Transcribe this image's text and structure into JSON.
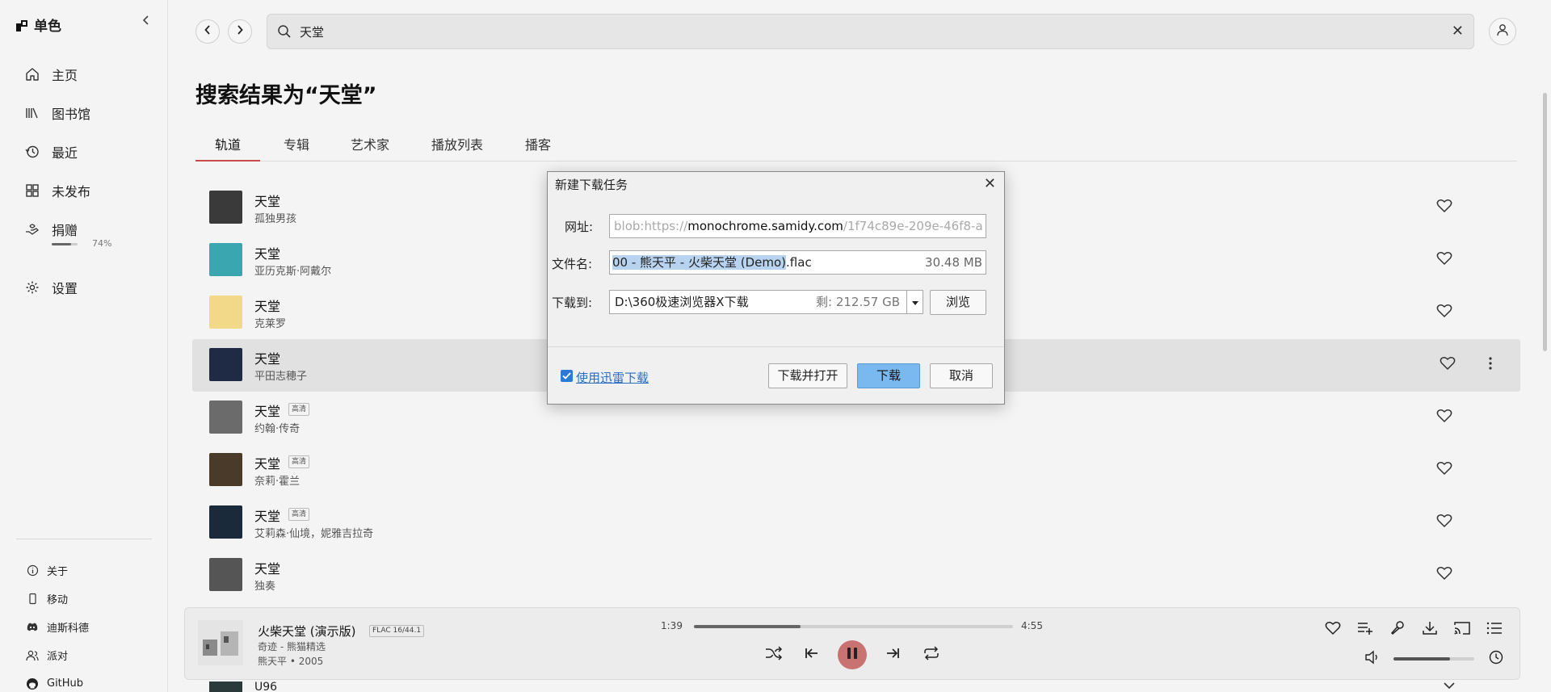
{
  "app": {
    "brand": "单色",
    "collapse_glyph": "‹"
  },
  "sidebar": {
    "items": [
      {
        "label": "主页",
        "icon": "home-icon"
      },
      {
        "label": "图书馆",
        "icon": "library-icon"
      },
      {
        "label": "最近",
        "icon": "history-icon"
      },
      {
        "label": "未发布",
        "icon": "grid-icon"
      },
      {
        "label": "捐赠",
        "icon": "donate-icon"
      },
      {
        "label": "设置",
        "icon": "gear-icon"
      }
    ],
    "donate_progress_percent": 74,
    "donate_progress_label": "74%",
    "bottom": [
      {
        "label": "关于",
        "icon": "info-icon"
      },
      {
        "label": "移动",
        "icon": "phone-icon"
      },
      {
        "label": "迪斯科德",
        "icon": "discord-icon"
      },
      {
        "label": "派对",
        "icon": "people-icon"
      },
      {
        "label": "GitHub",
        "icon": "github-icon"
      }
    ]
  },
  "search": {
    "value": "天堂",
    "clear_glyph": "✕"
  },
  "results": {
    "title": "搜索结果为“天堂”",
    "tabs": [
      "轨道",
      "专辑",
      "艺术家",
      "播放列表",
      "播客"
    ],
    "active_tab": 0,
    "tracks": [
      {
        "title": "天堂",
        "artist": "孤独男孩",
        "hq": "",
        "cover_color": "#3a3a3a"
      },
      {
        "title": "天堂",
        "artist": "亚历克斯·阿戴尔",
        "hq": "",
        "cover_color": "#3aa6b0"
      },
      {
        "title": "天堂",
        "artist": "克莱罗",
        "hq": "",
        "cover_color": "#f2d98a"
      },
      {
        "title": "天堂",
        "artist": "平田志穂子",
        "hq": "",
        "cover_color": "#1f2a44"
      },
      {
        "title": "天堂",
        "artist": "约翰·传奇",
        "hq": "高清",
        "cover_color": "#6b6b6b"
      },
      {
        "title": "天堂",
        "artist": "奈莉·霍兰",
        "hq": "高清",
        "cover_color": "#4a3a2a"
      },
      {
        "title": "天堂",
        "artist": "艾莉森·仙境，妮雅吉拉奇",
        "hq": "高清",
        "cover_color": "#1a2a3a"
      },
      {
        "title": "天堂",
        "artist": "独奏",
        "hq": "",
        "cover_color": "#555555"
      }
    ],
    "next_peek_title": "U96"
  },
  "player": {
    "title": "火柴天堂 (演示版)",
    "badge": "FLAC 16/44.1",
    "album": "奇迹 - 熊猫精选",
    "artist_year": "熊天平 • 2005",
    "current_time": "1:39",
    "total_time": "4:55",
    "progress_fraction": 0.335,
    "volume_fraction": 0.7
  },
  "dialog": {
    "title": "新建下载任务",
    "close_glyph": "✕",
    "url_label": "网址:",
    "url_prefix": "blob:https://",
    "url_host": "monochrome.samidy.com",
    "url_suffix": "/1f74c89e-209e-46f8-a",
    "filename_label": "文件名:",
    "filename_selected": "00 - 熊天平 - 火柴天堂 (Demo)",
    "filename_ext": ".flac",
    "file_size": "30.48 MB",
    "saveto_label": "下载到:",
    "path": "D:\\360极速浏览器X下载",
    "free_space": "剩: 212.57 GB",
    "browse_label": "浏览",
    "thunder_label": "使用迅雷下载",
    "download_open_label": "下载并打开",
    "download_label": "下载",
    "cancel_label": "取消"
  }
}
